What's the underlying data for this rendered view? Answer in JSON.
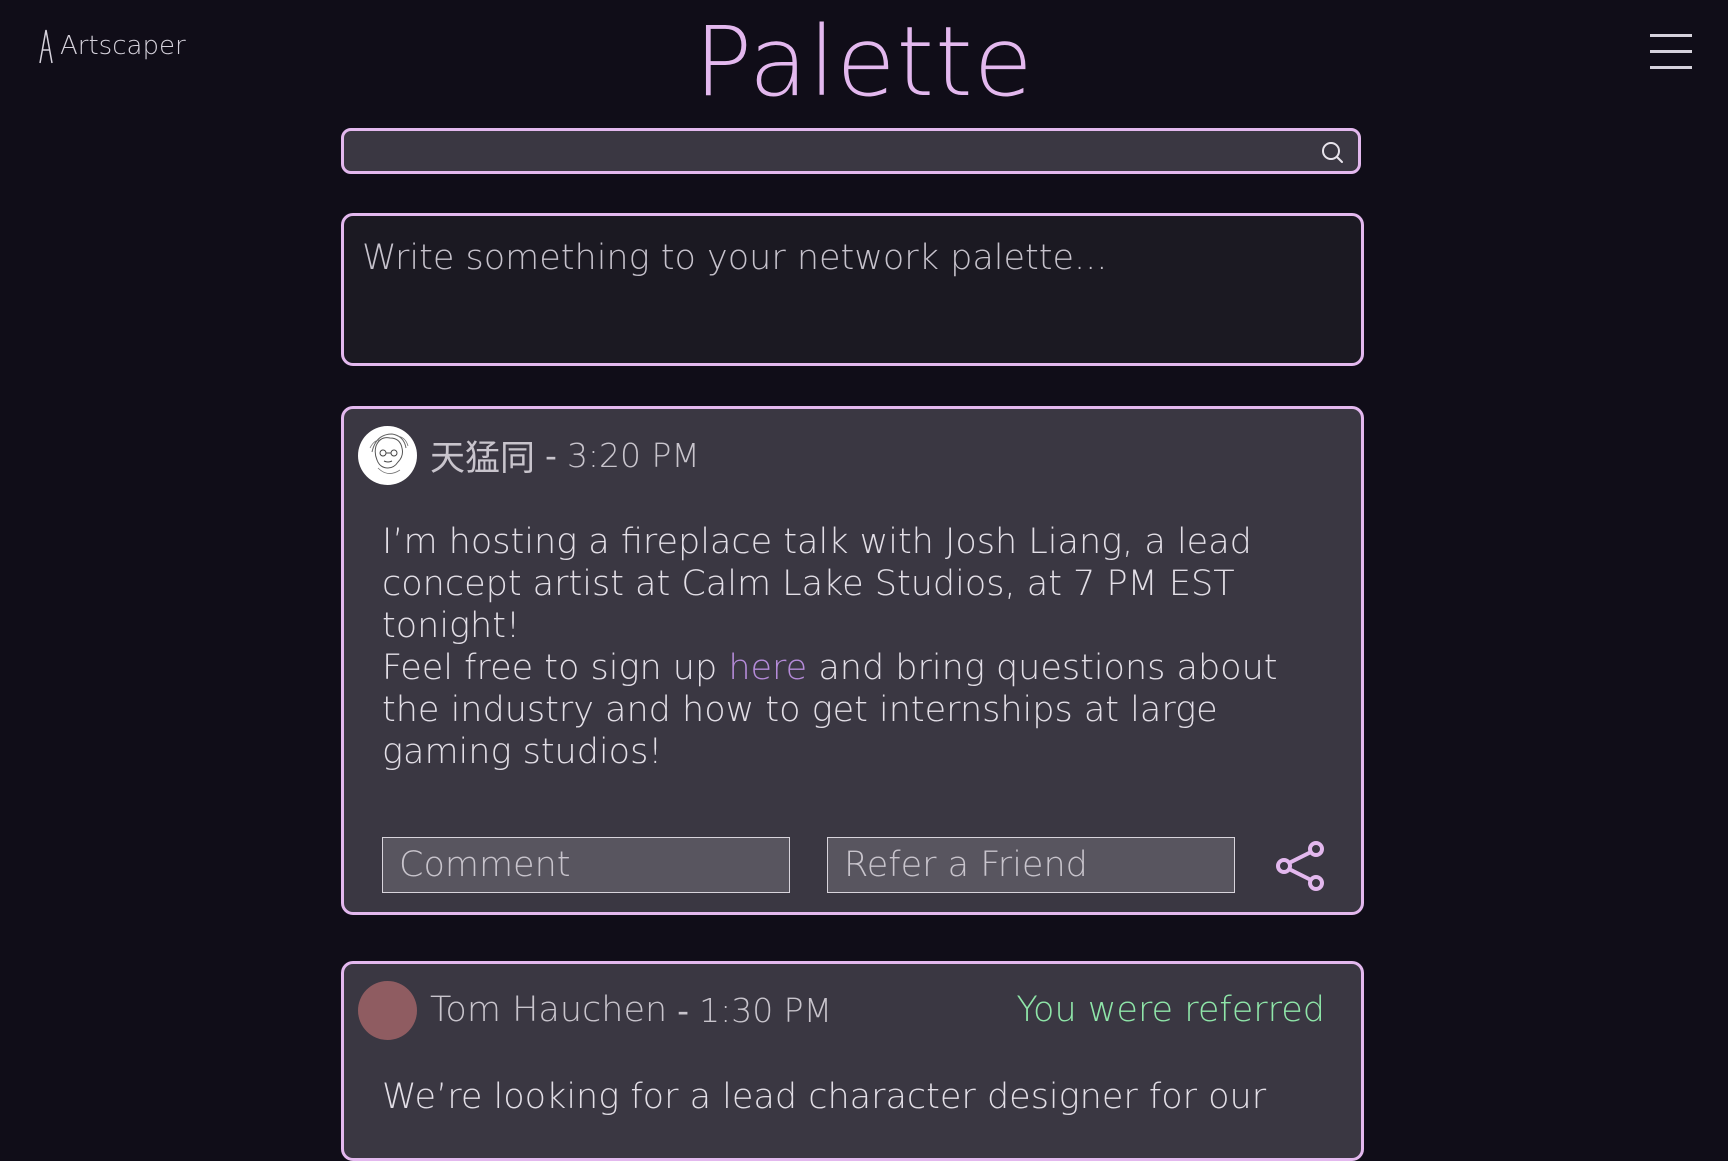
{
  "brand": {
    "name": "Artscaper",
    "icon": "a-logo-icon"
  },
  "app": {
    "title": "Palette"
  },
  "menu": {
    "icon": "hamburger-menu-icon"
  },
  "search": {
    "value": "",
    "placeholder": "",
    "icon": "search-icon"
  },
  "composer": {
    "placeholder": "Write something to your network palette..."
  },
  "posts": [
    {
      "author": "天猛同",
      "separator": "-",
      "time": "3:20 PM",
      "avatar": "sketch-portrait-avatar",
      "body_line_1": "I’m hosting a fireplace talk with Josh Liang, a lead concept artist at Calm Lake Studios, at 7 PM EST tonight!",
      "body_line_2_before": "Feel free to sign up ",
      "body_link": "here",
      "body_line_2_after": " and bring questions about the industry and how to get internships at large gaming studios!",
      "comment_placeholder": "Comment",
      "refer_placeholder": "Refer a Friend",
      "share_icon": "share-icon"
    },
    {
      "author": "Tom Hauchen",
      "separator": "-",
      "time": "1:30 PM",
      "avatar": "plain-avatar",
      "badge": "You were referred",
      "body_line_1": "We’re looking for a lead character designer for our"
    }
  ],
  "colors": {
    "background": "#100d18",
    "accent": "#e3b8ee",
    "card": "#3a3742",
    "link": "#b58bd9",
    "referred": "#8fe6a9",
    "avatar_plain": "#8f5c61"
  }
}
